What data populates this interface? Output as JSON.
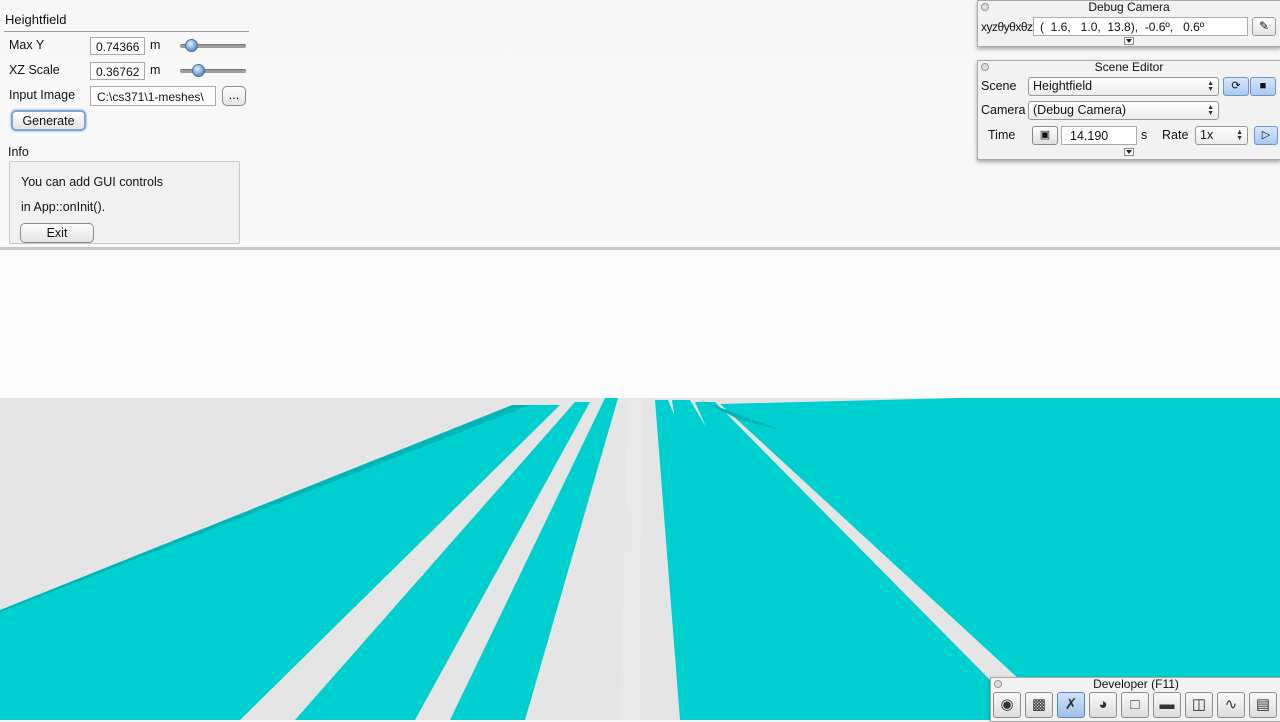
{
  "heightfield": {
    "title": "Heightfield",
    "max_y": {
      "label": "Max Y",
      "value": "0.74366",
      "unit": "m",
      "slider": 0.17
    },
    "xz_scale": {
      "label": "XZ Scale",
      "value": "0.36762",
      "unit": "m",
      "slider": 0.28
    },
    "input_image": {
      "label": "Input Image",
      "value": "C:\\cs371\\1-meshes\\",
      "browse_label": "..."
    },
    "generate_label": "Generate",
    "info": {
      "label": "Info",
      "lines": [
        "You can add GUI controls",
        "in App::onInit()."
      ],
      "exit_label": "Exit"
    }
  },
  "debug_camera": {
    "title": "Debug Camera",
    "xyz_label": "xyzθyθxθz",
    "coords": "(  1.6,   1.0,  13.8),  -0.6º,   0.6º",
    "edit_icon": "pencil-icon"
  },
  "scene_editor": {
    "title": "Scene Editor",
    "scene_label": "Scene",
    "scene_value": "Heightfield",
    "camera_label": "Camera",
    "camera_value": "(Debug Camera)",
    "time_label": "Time",
    "time_value": "14.190",
    "time_unit": "s",
    "rate_label": "Rate",
    "rate_value": "1x",
    "icons": [
      "reload-icon",
      "lock-icon",
      "film-icon",
      "play-icon"
    ]
  },
  "developer": {
    "title": "Developer (F11)",
    "icons": [
      "camera-icon",
      "clapperboard-icon",
      "tools-icon",
      "speedometer-icon",
      "new-window-icon",
      "console-icon",
      "scene-graph-icon",
      "profiler-icon",
      "document-icon"
    ]
  },
  "colors": {
    "terrain": "#00cfd0",
    "terrain_dark": "#00b5b8",
    "ground": "#e6e6e6",
    "sky": "#ffffff",
    "accent": "#6f9ad3"
  }
}
